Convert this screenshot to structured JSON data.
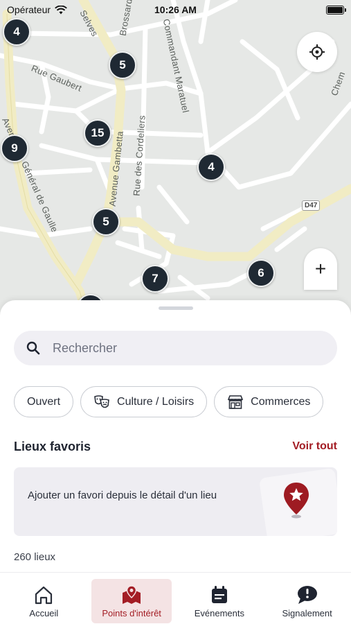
{
  "status_bar": {
    "carrier": "Opérateur",
    "time": "10:26 AM"
  },
  "map": {
    "street_labels": [
      "Rue Gaubert",
      "Avenue Gambetta",
      "Rue des Cordeliers",
      "Commandant Maratuel",
      "Avenue du Général de Gaulle",
      "Selves",
      "Brossard",
      "Chem"
    ],
    "road_badge": "D47",
    "clusters": [
      "4",
      "5",
      "15",
      "9",
      "4",
      "5",
      "7",
      "6"
    ],
    "zoom_in_label": "+",
    "colors": {
      "cluster": "#1f2933",
      "road_main": "#f1ecc4",
      "land": "#e6e8e6"
    }
  },
  "search": {
    "placeholder": "Rechercher",
    "value": ""
  },
  "filters": [
    {
      "label": "Ouvert",
      "icon": ""
    },
    {
      "label": "Culture / Loisirs",
      "icon": "theater-masks-icon"
    },
    {
      "label": "Commerces",
      "icon": "store-icon"
    }
  ],
  "favorites": {
    "title": "Lieux favoris",
    "see_all": "Voir tout",
    "empty_text": "Ajouter un favori depuis le détail d'un lieu"
  },
  "places_count": "260 lieux",
  "tabs": [
    {
      "label": "Accueil",
      "icon": "home-icon",
      "active": false
    },
    {
      "label": "Points d'intérêt",
      "icon": "map-pins-icon",
      "active": true
    },
    {
      "label": "Evénements",
      "icon": "calendar-icon",
      "active": false
    },
    {
      "label": "Signalement",
      "icon": "report-bubble-icon",
      "active": false
    }
  ],
  "colors": {
    "accent": "#a31d25",
    "active_tab_bg": "#f4e3e4",
    "search_bg": "#f0eff4"
  }
}
